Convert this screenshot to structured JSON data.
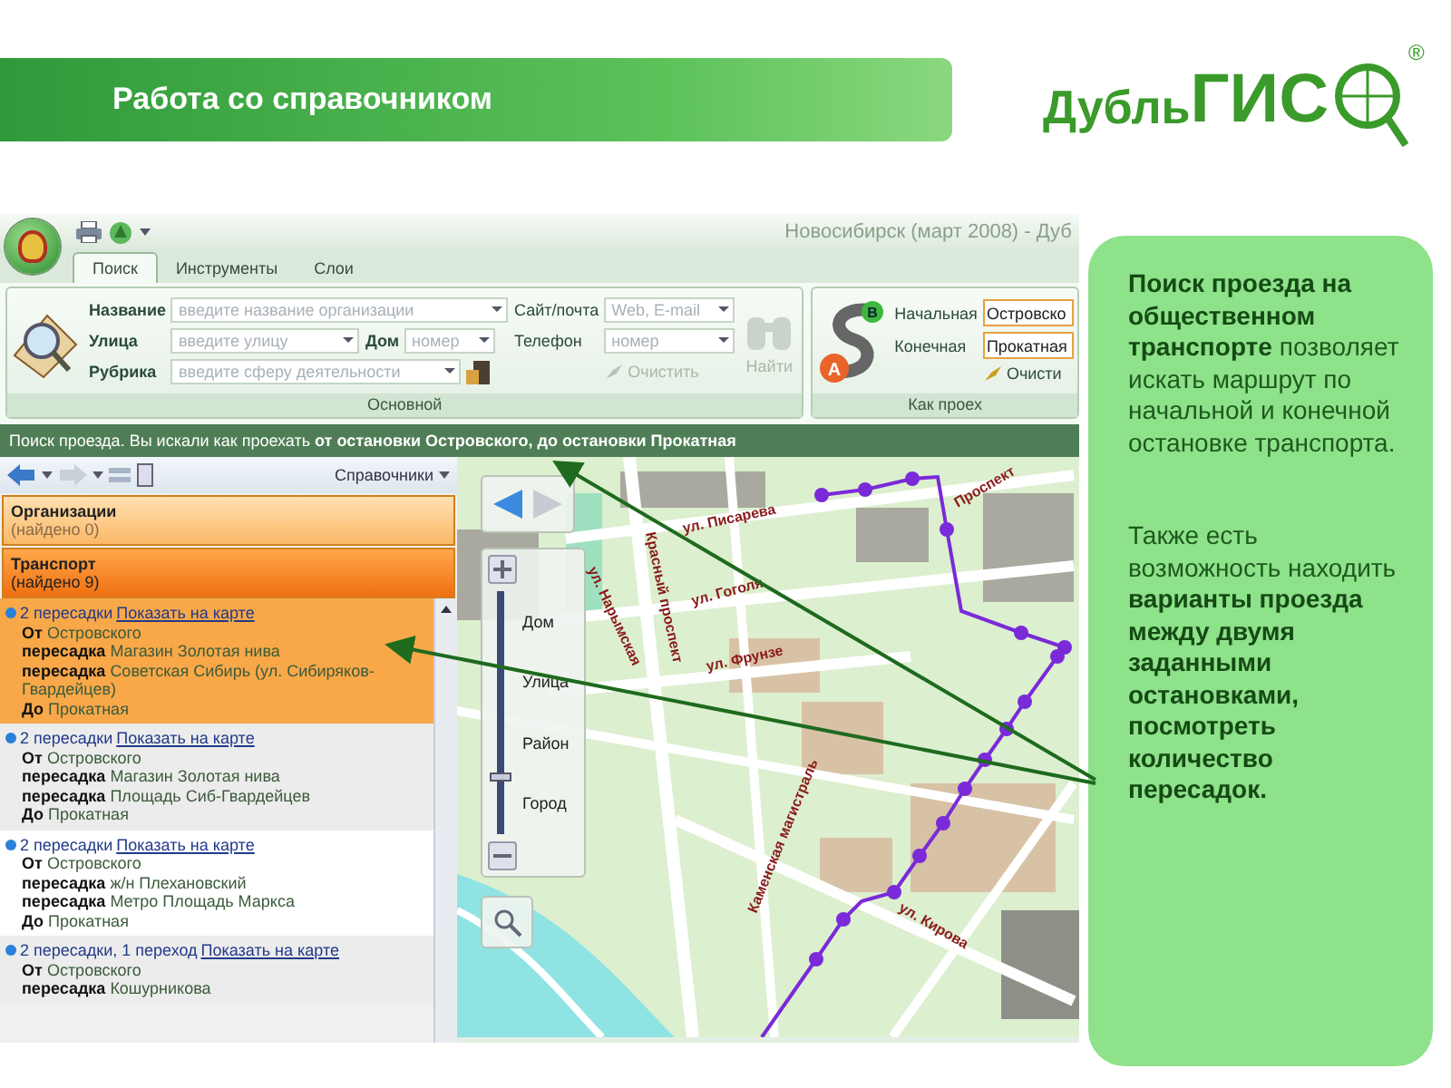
{
  "slide": {
    "title": "Работа со справочником",
    "logo": {
      "part_1": "Дубль",
      "part_2": "ГИС",
      "registered": "®"
    }
  },
  "app": {
    "window_title": "Новосибирск (март 2008) - Дуб",
    "tabs": [
      {
        "label": "Поиск",
        "selected": true
      },
      {
        "label": "Инструменты",
        "selected": false
      },
      {
        "label": "Слои",
        "selected": false
      }
    ],
    "search_group": {
      "label": "Основной",
      "name_field": {
        "label": "Название",
        "placeholder": "введите название организации"
      },
      "street_field": {
        "label": "Улица",
        "placeholder": "введите улицу"
      },
      "house_field": {
        "label": "Дом",
        "placeholder": "номер"
      },
      "rubric_field": {
        "label": "Рубрика",
        "placeholder": "введите сферу деятельности"
      },
      "site_field": {
        "label": "Сайт/почта",
        "placeholder": "Web, E-mail"
      },
      "phone_field": {
        "label": "Телефон",
        "placeholder": "номер"
      },
      "find_button": {
        "label": "Найти",
        "disabled": true
      },
      "clear_button": {
        "label": "Очистить",
        "disabled": true
      }
    },
    "route_group": {
      "label": "Как проех",
      "start_marker": "A",
      "end_marker": "B",
      "start_field": {
        "label": "Начальная",
        "value": "Островско"
      },
      "end_field": {
        "label": "Конечная",
        "value": "Прокатная"
      },
      "clear_button": {
        "label": "Очисти",
        "disabled": false
      }
    },
    "status_bar": "Поиск проезда. Вы искали как проехать **от остановки Островского, до остановки Прокатная**",
    "directory_button": "Справочники",
    "sections": [
      {
        "title": "Организации",
        "count": "(найдено 0)",
        "selected": false
      },
      {
        "title": "Транспорт",
        "count": "(найдено 9)",
        "selected": true
      }
    ],
    "results": [
      {
        "selected": true,
        "summary": "2 пересадки",
        "link": "Показать на карте",
        "stops": [
          {
            "role": "От",
            "name": "Островского"
          },
          {
            "role": "пересадка",
            "name": "Магазин Золотая нива"
          },
          {
            "role": "пересадка",
            "name": "Советская Сибирь (ул. Сибиряков-Гвардейцев)"
          },
          {
            "role": "До",
            "name": "Прокатная"
          }
        ]
      },
      {
        "selected": false,
        "summary": "2 пересадки",
        "link": "Показать на карте",
        "stops": [
          {
            "role": "От",
            "name": "Островского"
          },
          {
            "role": "пересадка",
            "name": "Магазин Золотая нива"
          },
          {
            "role": "пересадка",
            "name": "Площадь Сиб-Гвардейцев"
          },
          {
            "role": "До",
            "name": "Прокатная"
          }
        ]
      },
      {
        "selected": false,
        "summary": "2 пересадки",
        "link": "Показать на карте",
        "stops": [
          {
            "role": "От",
            "name": "Островского"
          },
          {
            "role": "пересадка",
            "name": "ж/н Плехановский"
          },
          {
            "role": "пересадка",
            "name": "Метро Площадь Маркса"
          },
          {
            "role": "До",
            "name": "Прокатная"
          }
        ]
      },
      {
        "selected": false,
        "summary": "2 пересадки, 1 переход",
        "link": "Показать на карте",
        "stops": [
          {
            "role": "От",
            "name": "Островского"
          },
          {
            "role": "пересадка",
            "name": "Кошурникова"
          }
        ]
      }
    ],
    "map": {
      "streets": [
        "ул. Писарева",
        "ул. Гоголя",
        "ул. Фрунзе",
        "Красный проспект",
        "ул. Нарымская",
        "Каменская магистраль",
        "ул. Кирова",
        "Проспект"
      ],
      "zoom": {
        "levels": [
          "Дом",
          "Улица",
          "Район",
          "Город"
        ],
        "level": 0.22
      }
    }
  },
  "callout": [
    "**Поиск проезда на общественном транспорте** позволяет искать маршрут по начальной и конечной остановке транспорта.",
    "Также есть возможность находить **варианты проезда между двумя заданными остановками, посмотреть количество пересадок.**"
  ]
}
